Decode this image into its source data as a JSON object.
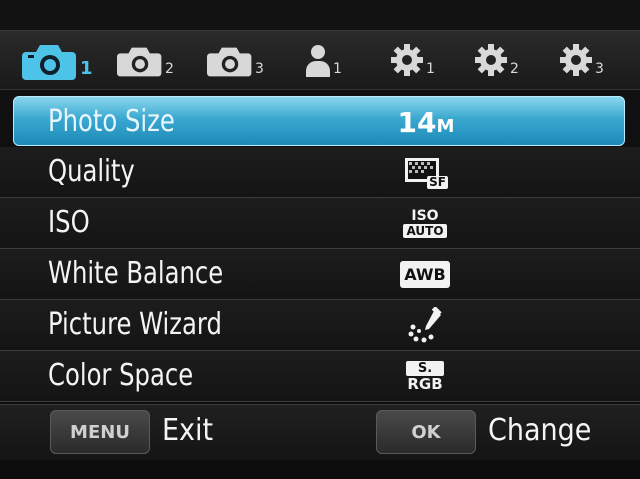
{
  "tabs": [
    {
      "icon": "camera-icon",
      "sub": "1",
      "active": true
    },
    {
      "icon": "camera-icon",
      "sub": "2",
      "active": false
    },
    {
      "icon": "camera-icon",
      "sub": "3",
      "active": false
    },
    {
      "icon": "person-icon",
      "sub": "1",
      "active": false
    },
    {
      "icon": "gear-icon",
      "sub": "1",
      "active": false
    },
    {
      "icon": "gear-icon",
      "sub": "2",
      "active": false
    },
    {
      "icon": "gear-icon",
      "sub": "3",
      "active": false
    }
  ],
  "menu": {
    "items": [
      {
        "label": "Photo Size",
        "value": "14",
        "value_unit": "M",
        "selected": true
      },
      {
        "label": "Quality",
        "value_icon": "quality-superfine-icon",
        "value_badge": "SF"
      },
      {
        "label": "ISO",
        "value_top": "ISO",
        "value_badge": "AUTO"
      },
      {
        "label": "White Balance",
        "value_badge": "AWB"
      },
      {
        "label": "Picture Wizard",
        "value_icon": "picture-wizard-icon"
      },
      {
        "label": "Color Space",
        "value_top": "S.",
        "value_bottom": "RGB"
      }
    ]
  },
  "footer": {
    "menu_button": "MENU",
    "menu_action": "Exit",
    "ok_button": "OK",
    "ok_action": "Change"
  },
  "colors": {
    "accent": "#3aa8d0",
    "active_tab": "#4ec3e8",
    "background": "#121212"
  }
}
